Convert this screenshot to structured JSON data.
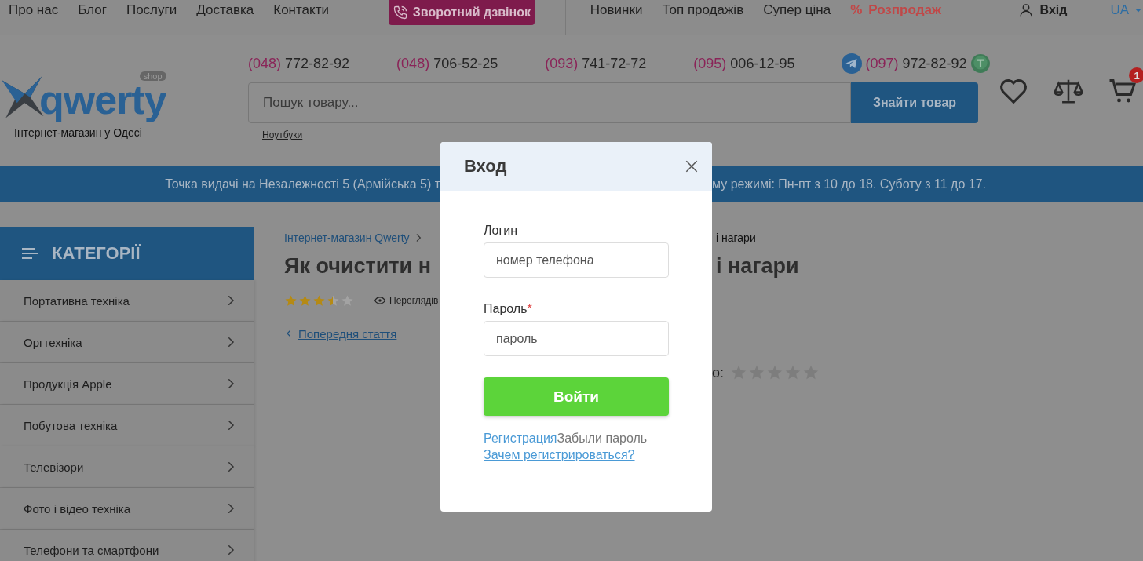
{
  "top_nav": {
    "links": [
      "Про нас",
      "Блог",
      "Послуги",
      "Доставка",
      "Контакти"
    ],
    "callback_button": "Зворотний дзвінок",
    "sections": [
      {
        "label": "Новинки",
        "kind": "link"
      },
      {
        "label": "Топ продажів",
        "kind": "link"
      },
      {
        "label": "Супер ціна",
        "kind": "link"
      },
      {
        "label": "Розпродаж",
        "kind": "sale",
        "mark": "%"
      }
    ],
    "login": "Вхід",
    "language": "UA"
  },
  "header": {
    "logo": {
      "name": "qwerty",
      "badge": "shop",
      "tagline": "Інтернет-магазин у Одесі"
    },
    "phones": [
      {
        "code": "(048)",
        "number": "772-82-92",
        "kind": "plain"
      },
      {
        "code": "(048)",
        "number": "706-52-25",
        "kind": "plain"
      },
      {
        "code": "(093)",
        "number": "741-72-72",
        "kind": "plain"
      },
      {
        "code": "(095)",
        "number": "006-12-95",
        "kind": "plain"
      },
      {
        "code": "(097)",
        "number": "972-82-92",
        "kind": "messengers"
      }
    ],
    "search": {
      "placeholder": "Пошук товару...",
      "button": "Знайти товар",
      "hint": "Ноутбуки"
    },
    "cart": {
      "count": "1"
    }
  },
  "banner": {
    "text_before": "Точка видачі на Незалежності 5 (Армійська 5) т",
    "text_after": "му режимі: Пн-пт з 10 до 18. Суботу з 11 до 17."
  },
  "sidebar": {
    "title": "КАТЕГОРІЇ",
    "items": [
      "Портативна техніка",
      "Оргтехніка",
      "Продукція Apple",
      "Побутова техніка",
      "Телевізори",
      "Фото і відео техніка",
      "Телефони та смартфони"
    ]
  },
  "article": {
    "breadcrumb_home": "Інтернет-магазин Qwerty",
    "breadcrumb_tail": "і нагари",
    "title_start": "Як очистити н",
    "title_end": "і нагари",
    "stars": 3.5,
    "views_label": "Переглядів",
    "prev_link": "Попередня стаття",
    "rate": {
      "label": "о:"
    }
  },
  "modal": {
    "title": "Вход",
    "fields": [
      {
        "label": "Логин",
        "placeholder": "номер телефона"
      },
      {
        "label": "Пароль",
        "placeholder": "пароль",
        "required_mark": "*"
      }
    ],
    "submit": "Войти",
    "register_link": "Регистрация",
    "forgot_link": "Забыли пароль",
    "why_link": "Зачем регистрироваться?"
  }
}
